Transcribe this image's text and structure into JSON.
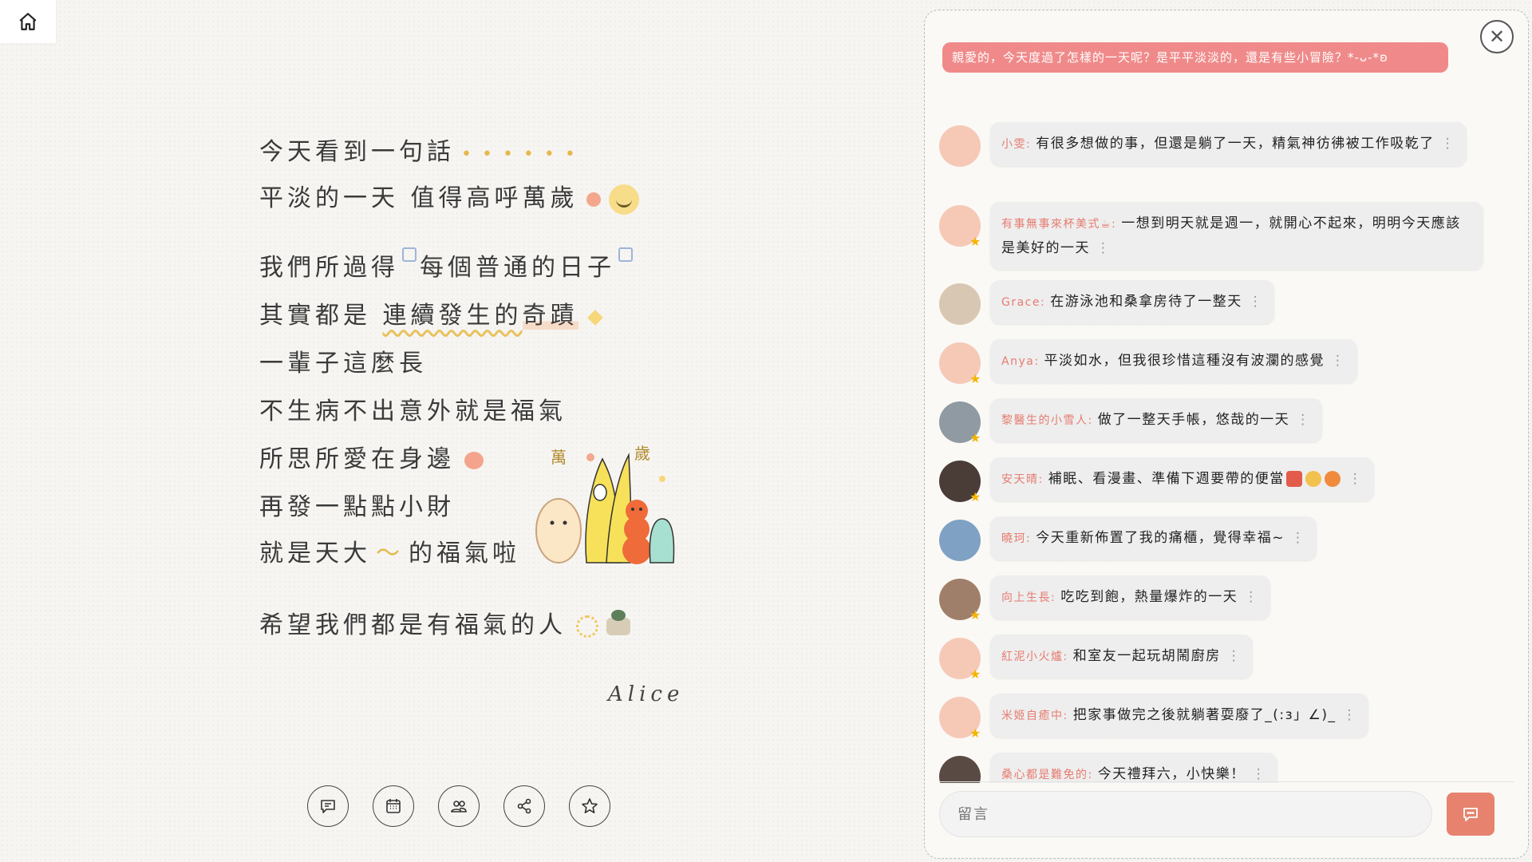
{
  "nav": {
    "home_icon": "home-icon"
  },
  "poem": {
    "lines": [
      "今天看到一句話",
      "平淡的一天 值得高呼萬歲",
      "我們所過得",
      "每個普通的日子",
      "其實都是",
      "連續發生的",
      "奇蹟",
      "一輩子這麼長",
      "不生病不出意外就是福氣",
      "所思所愛在身邊",
      "再發一點點小財",
      "就是天大",
      "的福氣啦",
      "希望我們都是有福氣的人"
    ],
    "signature": "Alice",
    "illustration_labels": [
      "萬",
      "歲"
    ]
  },
  "toolbar": {
    "items": [
      {
        "name": "comment",
        "icon": "comment-icon"
      },
      {
        "name": "calendar",
        "icon": "calendar-icon"
      },
      {
        "name": "friends",
        "icon": "users-icon"
      },
      {
        "name": "share",
        "icon": "share-icon"
      },
      {
        "name": "favorite",
        "icon": "star-icon"
      }
    ]
  },
  "panel": {
    "close_icon": "close-icon",
    "prompt": "親愛的，今天度過了怎樣的一天呢？是平平淡淡的，還是有些小冒險？*-ᴗ-*ʚ",
    "messages": [
      {
        "author": "小雯:",
        "text": "有很多想做的事，但還是躺了一天，精氣神彷彿被工作吸乾了",
        "avatar_color": "#f6c9b7",
        "badge": false
      },
      {
        "author": "有事無事來杯美式☕:",
        "text": "一想到明天就是週一，就開心不起來，明明今天應該是美好的一天",
        "avatar_color": "#f6c9b7",
        "badge": true
      },
      {
        "author": "Grace:",
        "text": "在游泳池和桑拿房待了一整天",
        "avatar_color": "#d8c7b2",
        "badge": false
      },
      {
        "author": "Anya:",
        "text": "平淡如水，但我很珍惜這種沒有波瀾的感覺",
        "avatar_color": "#f6c9b7",
        "badge": true
      },
      {
        "author": "黎醫生的小雪人:",
        "text": "做了一整天手帳，悠哉的一天",
        "avatar_color": "#8f9aa3",
        "badge": true
      },
      {
        "author": "安天晴:",
        "text": "補眠、看漫畫、準備下週要帶的便當",
        "avatar_color": "#4a3c36",
        "badge": true
      },
      {
        "author": "曉珂:",
        "text": "今天重新佈置了我的痛櫃，覺得幸福~",
        "avatar_color": "#7fa1c4",
        "badge": false
      },
      {
        "author": "向上生長:",
        "text": "吃吃到飽，熱量爆炸的一天",
        "avatar_color": "#a07f6a",
        "badge": true
      },
      {
        "author": "紅泥小火爐:",
        "text": "和室友一起玩胡鬧廚房",
        "avatar_color": "#f6c9b7",
        "badge": true
      },
      {
        "author": "米姬自癒中:",
        "text": "把家事做完之後就躺著耍廢了_(:з」∠)_",
        "avatar_color": "#f6c9b7",
        "badge": true
      },
      {
        "author": "桑心都是難免的:",
        "text": "今天禮拜六，小快樂！",
        "avatar_color": "#5a4a44",
        "badge": false
      }
    ],
    "more_icon": "more-vertical-icon",
    "composer": {
      "placeholder": "留言",
      "value": "",
      "send_icon": "send-comment-icon"
    }
  },
  "colors": {
    "accent": "#f08a8a",
    "send_button": "#e6826e",
    "author": "#e67c70",
    "bubble": "#eeeeee"
  }
}
